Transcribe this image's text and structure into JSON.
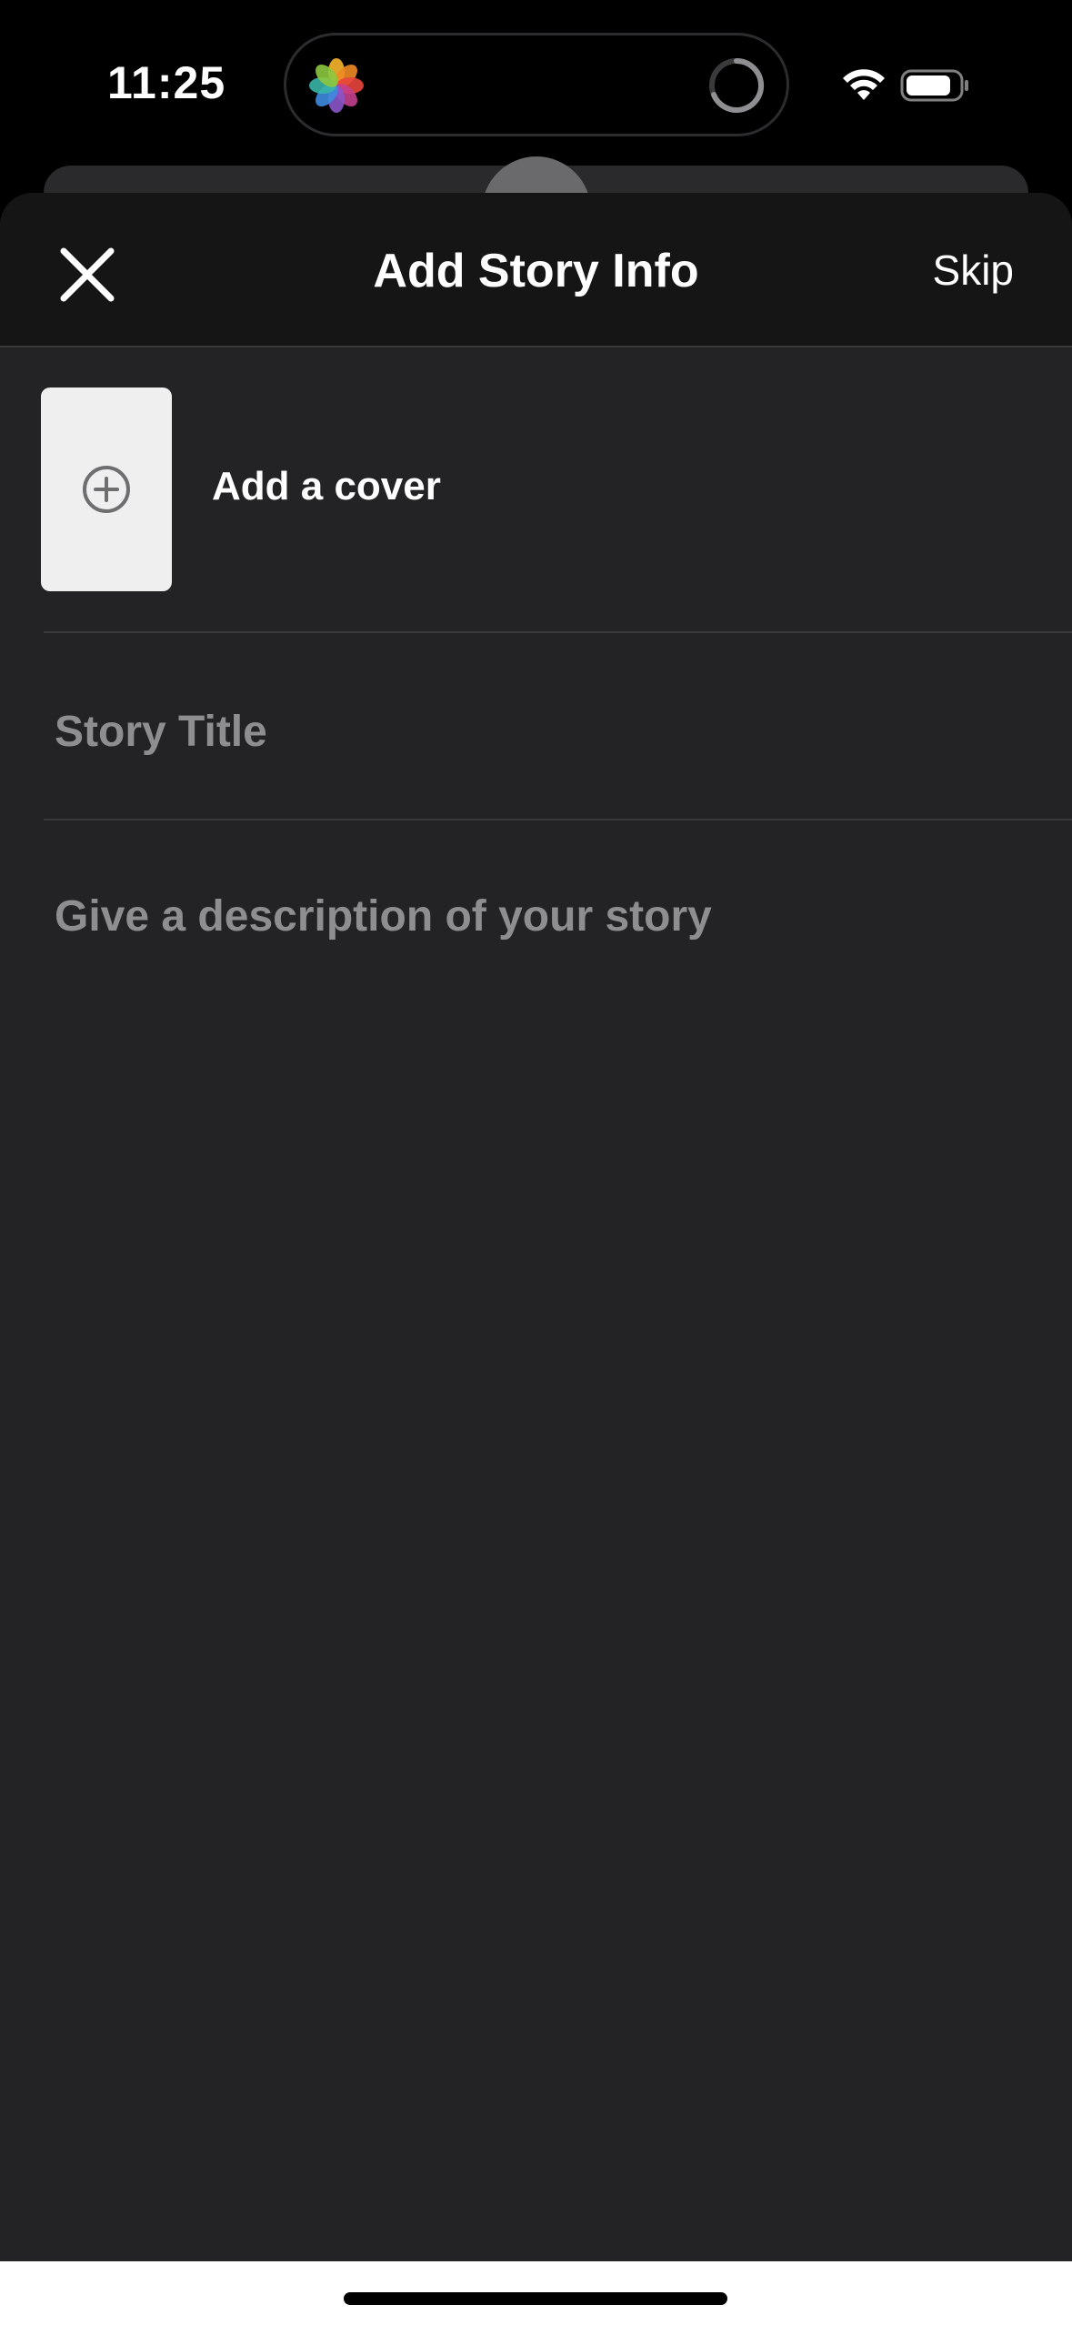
{
  "status_bar": {
    "time": "11:25",
    "icons": [
      "photos-icon",
      "activity-ring-icon",
      "wifi-icon",
      "battery-icon"
    ]
  },
  "nav": {
    "title": "Add Story Info",
    "skip_label": "Skip",
    "close_icon": "close-icon"
  },
  "cover": {
    "label": "Add a cover",
    "icon": "add-circle-icon"
  },
  "form": {
    "title_placeholder": "Story Title",
    "description_placeholder": "Give a description of your story"
  },
  "colors": {
    "sheet_background": "#232325",
    "nav_background": "#151516",
    "placeholder": "#8e8e90",
    "cover_placeholder": "#efefef"
  }
}
